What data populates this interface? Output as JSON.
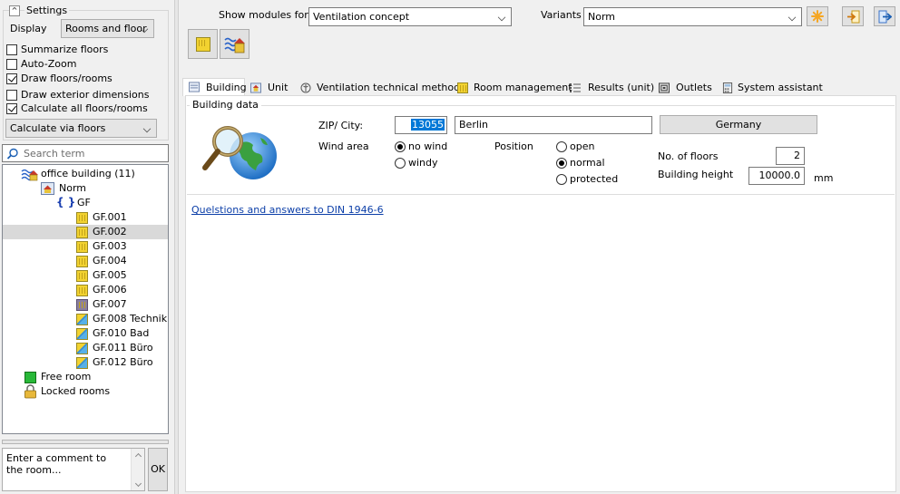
{
  "settings": {
    "title": "Settings",
    "display_label": "Display",
    "display_value": "Rooms and floor",
    "checkboxes": [
      {
        "label": "Summarize floors",
        "checked": false
      },
      {
        "label": "Auto-Zoom",
        "checked": false
      },
      {
        "label": "Draw floors/rooms",
        "checked": true
      },
      {
        "label": "Draw exterior dimensions",
        "checked": false
      },
      {
        "label": "Calculate all floors/rooms",
        "checked": true
      }
    ],
    "calc_mode": "Calculate via floors"
  },
  "search": {
    "placeholder": "Search term"
  },
  "tree": {
    "root": "office building (11)",
    "variant": "Norm",
    "floor": "GF",
    "rooms": [
      "GF.001",
      "GF.002",
      "GF.003",
      "GF.004",
      "GF.005",
      "GF.006",
      "GF.007",
      "GF.008 Technik",
      "GF.010 Bad",
      "GF.011 Büro",
      "GF.012 Büro"
    ],
    "selected_room": "GF.002",
    "free_room": "Free room",
    "locked_rooms": "Locked rooms"
  },
  "comment": {
    "placeholder": "Enter a comment to the room...",
    "ok_label": "OK"
  },
  "top": {
    "show_modules_label": "Show modules for",
    "module_value": "Ventilation concept",
    "variants_label": "Variants",
    "variant_value": "Norm"
  },
  "tabs": [
    {
      "label": "Building",
      "icon": "building-icon",
      "active": true
    },
    {
      "label": "Unit",
      "icon": "unit-icon"
    },
    {
      "label": "Ventilation technical methods",
      "icon": "ventilation-icon"
    },
    {
      "label": "Room management",
      "icon": "room-icon"
    },
    {
      "label": "Results (unit)",
      "icon": "list-icon"
    },
    {
      "label": "Outlets",
      "icon": "outlet-icon"
    },
    {
      "label": "System assistant",
      "icon": "calculator-icon"
    }
  ],
  "building": {
    "group_title": "Building data",
    "zip_label": "ZIP/ City:",
    "zip_value": "13055",
    "city_value": "Berlin",
    "country_button": "Germany",
    "wind_label": "Wind area",
    "wind_options": [
      "no wind",
      "windy"
    ],
    "wind_selected": "no wind",
    "position_label": "Position",
    "position_options": [
      "open",
      "normal",
      "protected"
    ],
    "position_selected": "normal",
    "floors_label": "No. of floors",
    "floors_value": "2",
    "height_label": "Building height",
    "height_value": "10000.0",
    "height_unit": "mm",
    "faq_link": "Quelstions and answers to DIN 1946-6"
  },
  "colors": {
    "selection": "#0078d7",
    "link": "#0b3ea8",
    "accent": "#f5a623"
  }
}
